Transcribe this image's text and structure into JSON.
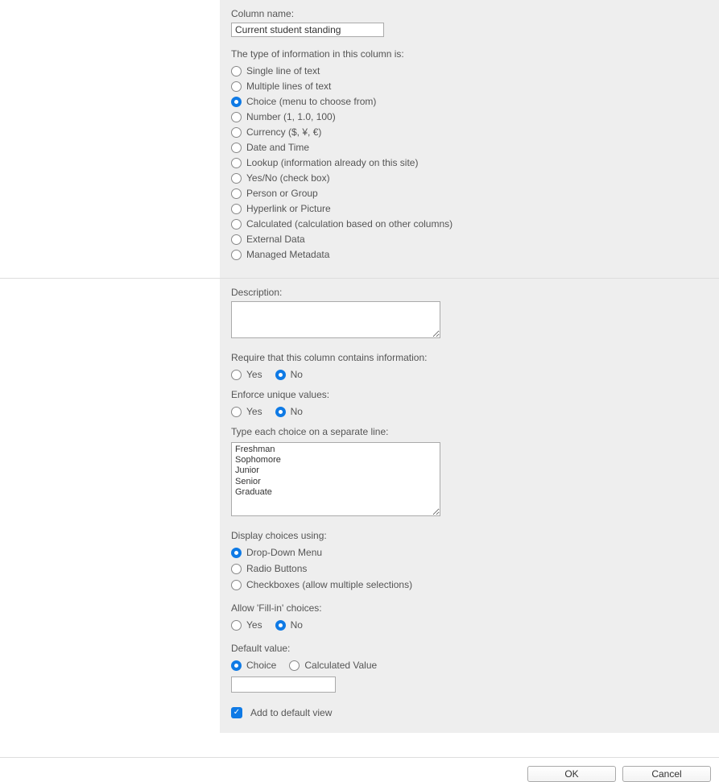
{
  "columnName": {
    "label": "Column name:",
    "value": "Current student standing"
  },
  "typeInfo": {
    "label": "The type of information in this column is:",
    "options": {
      "single": "Single line of text",
      "multi": "Multiple lines of text",
      "choice": "Choice (menu to choose from)",
      "number": "Number (1, 1.0, 100)",
      "currency": "Currency ($, ¥, €)",
      "datetime": "Date and Time",
      "lookup": "Lookup (information already on this site)",
      "yesno": "Yes/No (check box)",
      "person": "Person or Group",
      "hyperlink": "Hyperlink or Picture",
      "calculated": "Calculated (calculation based on other columns)",
      "external": "External Data",
      "managed": "Managed Metadata"
    }
  },
  "description": {
    "label": "Description:",
    "value": ""
  },
  "require": {
    "label": "Require that this column contains information:",
    "yes": "Yes",
    "no": "No"
  },
  "unique": {
    "label": "Enforce unique values:",
    "yes": "Yes",
    "no": "No"
  },
  "choices": {
    "label": "Type each choice on a separate line:",
    "value": "Freshman\nSophomore\nJunior\nSenior\nGraduate"
  },
  "display": {
    "label": "Display choices using:",
    "dropdown": "Drop-Down Menu",
    "radio": "Radio Buttons",
    "checkbox": "Checkboxes (allow multiple selections)"
  },
  "fillin": {
    "label": "Allow 'Fill-in' choices:",
    "yes": "Yes",
    "no": "No"
  },
  "defaultValue": {
    "label": "Default value:",
    "choice": "Choice",
    "calculated": "Calculated Value",
    "value": ""
  },
  "addDefault": {
    "label": "Add to default view"
  },
  "buttons": {
    "ok": "OK",
    "cancel": "Cancel"
  }
}
